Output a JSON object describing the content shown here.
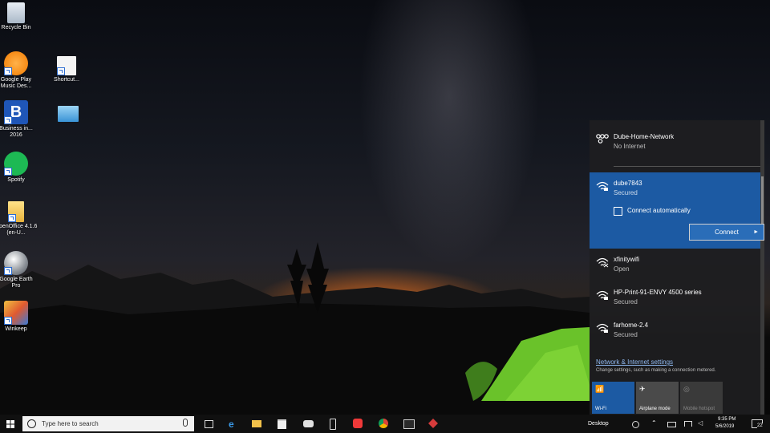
{
  "desktop": {
    "icons": [
      {
        "label": "Recycle Bin",
        "name": "recycle-bin-icon"
      },
      {
        "label": "Google Play Music Des...",
        "name": "google-play-music-icon"
      },
      {
        "label": "Shortcut...",
        "name": "shortcut-icon"
      },
      {
        "label": "Business in... 2016",
        "name": "business-app-icon"
      },
      {
        "label": "Spotify",
        "name": "spotify-icon"
      },
      {
        "label": "OpenOffice 4.1.6 (en-U...",
        "name": "openoffice-icon"
      },
      {
        "label": "Google Earth Pro",
        "name": "google-earth-icon"
      },
      {
        "label": "Winkeep",
        "name": "winkeep-icon"
      }
    ]
  },
  "network_flyout": {
    "connected": {
      "name": "Dube-Home-Network",
      "status": "No Internet"
    },
    "selected": {
      "name": "dube7843",
      "status": "Secured",
      "connect_auto_label": "Connect automatically",
      "connect_auto_checked": false,
      "connect_button": "Connect"
    },
    "networks": [
      {
        "name": "xfinitywifi",
        "status": "Open"
      },
      {
        "name": "HP-Print-91-ENVY 4500 series",
        "status": "Secured"
      },
      {
        "name": "farhome-2.4",
        "status": "Secured"
      }
    ],
    "settings_link": "Network & Internet settings",
    "settings_desc": "Change settings, such as making a connection metered.",
    "quick_actions": [
      {
        "label": "Wi-Fi",
        "state": "on"
      },
      {
        "label": "Airplane mode",
        "state": "off"
      },
      {
        "label": "Mobile hotspot",
        "state": "disabled"
      }
    ]
  },
  "taskbar": {
    "search_placeholder": "Type here to search",
    "desktop_label": "Desktop",
    "time": "9:35 PM",
    "date": "5/6/2019",
    "notification_count": "22"
  },
  "colors": {
    "accent": "#1c5aa3",
    "flyout_bg": "#1e1e20",
    "taskbar_bg": "#101010",
    "link": "#8fb8ef"
  }
}
